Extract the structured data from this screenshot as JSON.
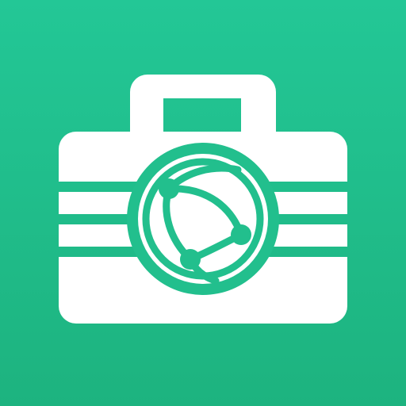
{
  "icon": {
    "name": "briefcase-globe-icon",
    "colors": {
      "background_top": "#23C796",
      "background_bottom": "#1DB37F",
      "foreground": "#FFFFFF"
    }
  }
}
